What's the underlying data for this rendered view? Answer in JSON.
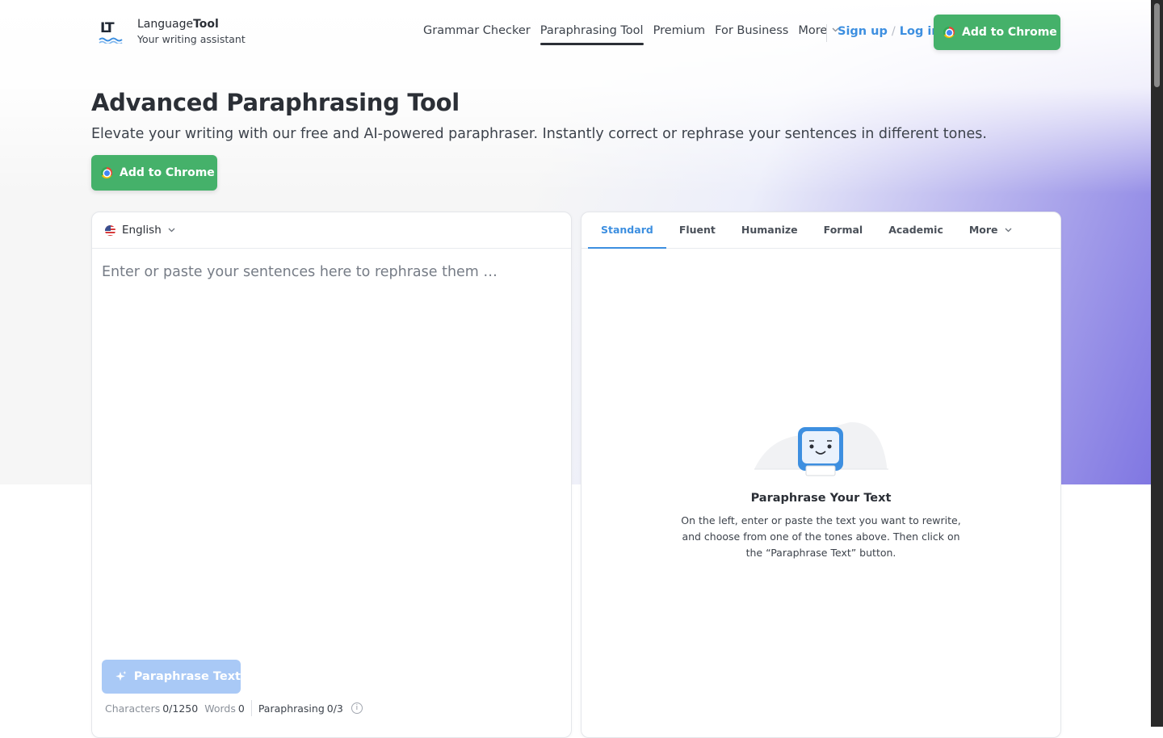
{
  "header": {
    "logo_name_regular": "Language",
    "logo_name_bold": "Tool",
    "logo_tagline": "Your writing assistant",
    "nav": [
      {
        "label": "Grammar Checker",
        "active": false
      },
      {
        "label": "Paraphrasing Tool",
        "active": true
      },
      {
        "label": "Premium",
        "active": false
      },
      {
        "label": "For Business",
        "active": false
      },
      {
        "label": "More",
        "active": false
      }
    ],
    "signup": "Sign up",
    "auth_separator": "/",
    "login": "Log in",
    "cta": "Add to Chrome"
  },
  "hero": {
    "title": "Advanced Paraphrasing Tool",
    "subtitle": "Elevate your writing with our free and AI-powered paraphraser. Instantly correct or rephrase your sentences in different tones.",
    "cta": "Add to Chrome"
  },
  "editor": {
    "language": "English",
    "placeholder": "Enter or paste your sentences here to rephrase them …",
    "paraphrase_button": "Paraphrase Text",
    "stats": {
      "characters_label": "Characters",
      "characters_value": "0/1250",
      "words_label": "Words",
      "words_value": "0",
      "paraphrasing_label": "Paraphrasing",
      "paraphrasing_value": "0/3"
    }
  },
  "output": {
    "tabs": [
      {
        "label": "Standard",
        "active": true
      },
      {
        "label": "Fluent",
        "active": false
      },
      {
        "label": "Humanize",
        "active": false
      },
      {
        "label": "Formal",
        "active": false
      },
      {
        "label": "Academic",
        "active": false
      },
      {
        "label": "More",
        "active": false
      }
    ],
    "empty_title": "Paraphrase Your Text",
    "empty_text": "On the left, enter or paste the text you want to rewrite, and choose from one of the tones above. Then click on the “Paraphrase Text” button."
  },
  "colors": {
    "accent_blue": "#3d8fe0",
    "green_cta": "#45b16a",
    "disabled_button": "#a9c9f6",
    "hero_gradient_end": "#8077e2"
  },
  "icons": [
    "languagetool-logo-icon",
    "chrome-icon",
    "chevron-down-icon",
    "us-flag-icon",
    "sparkle-icon",
    "info-icon",
    "robot-illustration-icon"
  ]
}
